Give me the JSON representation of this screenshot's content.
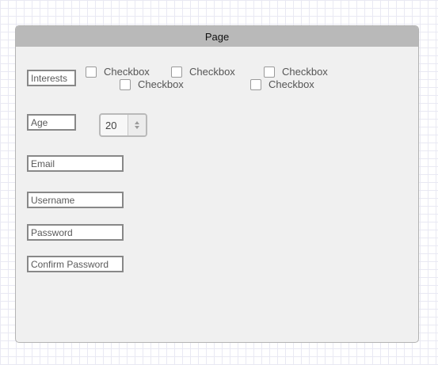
{
  "window": {
    "title": "Page"
  },
  "form": {
    "interests_label": "Interests",
    "interest_options": [
      {
        "label": "Checkbox",
        "checked": false
      },
      {
        "label": "Checkbox",
        "checked": false
      },
      {
        "label": "Checkbox",
        "checked": false
      },
      {
        "label": "Checkbox",
        "checked": false
      },
      {
        "label": "Checkbox",
        "checked": false
      }
    ],
    "age_label": "Age",
    "age_value": "20",
    "email_placeholder": "Email",
    "username_placeholder": "Username",
    "password_placeholder": "Password",
    "confirm_password_placeholder": "Confirm Password"
  }
}
